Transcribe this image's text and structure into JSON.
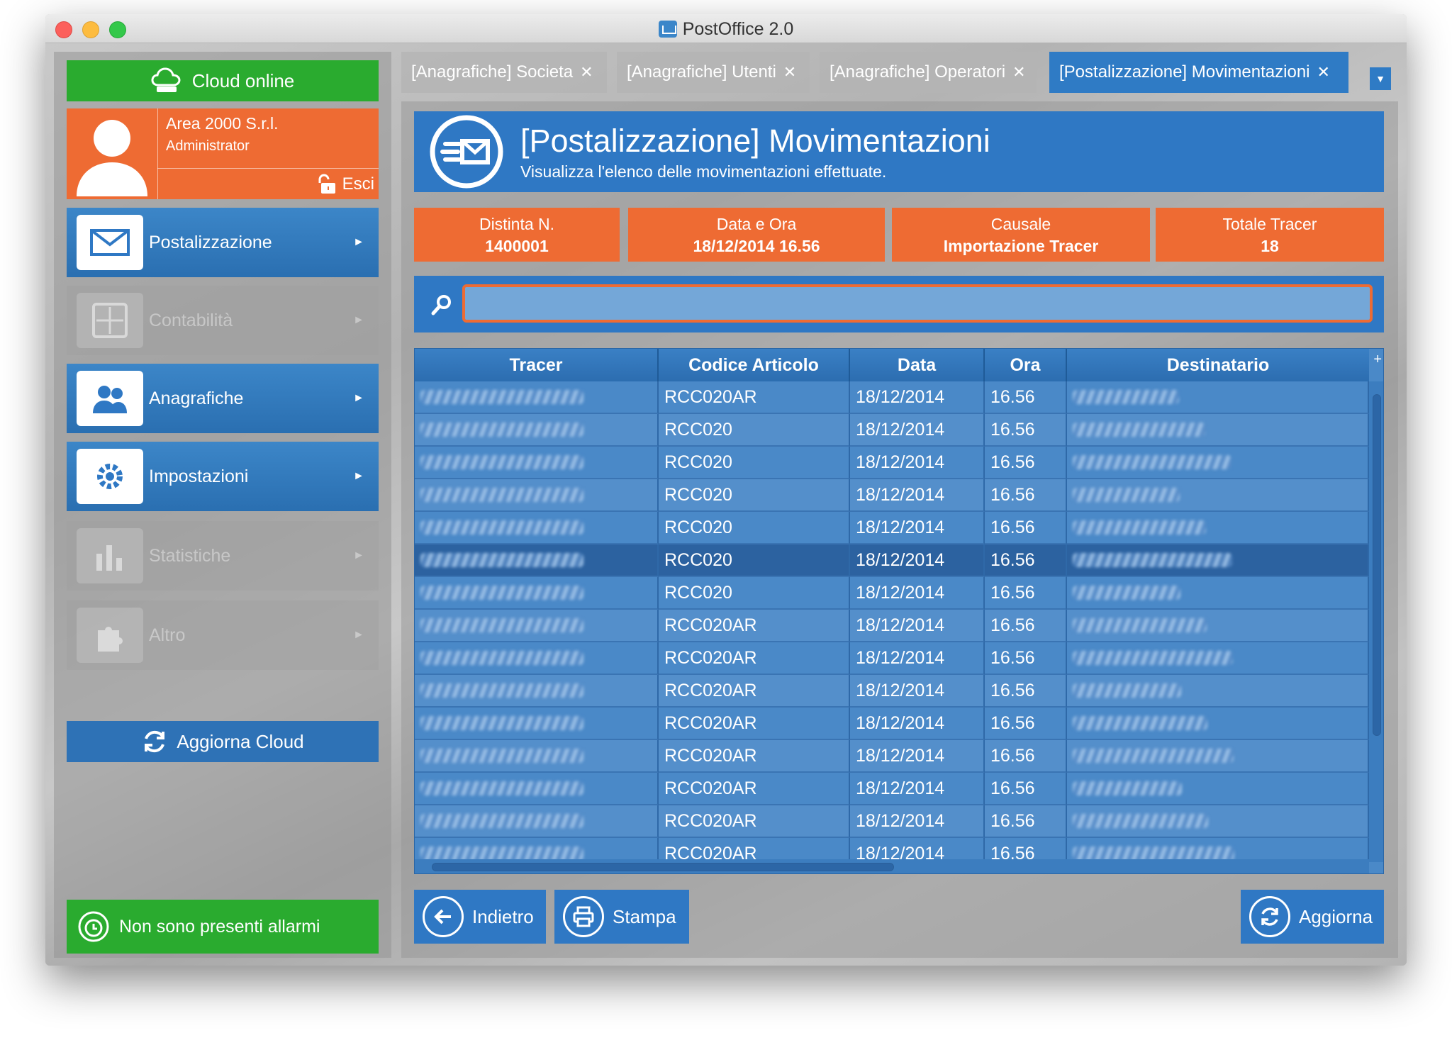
{
  "window": {
    "title": "PostOffice 2.0"
  },
  "sidebar": {
    "cloud_status": "Cloud online",
    "user": {
      "company": "Area 2000 S.r.l.",
      "role": "Administrator",
      "logout": "Esci"
    },
    "items": [
      {
        "label": "Postalizzazione",
        "enabled": true
      },
      {
        "label": "Contabilità",
        "enabled": false
      },
      {
        "label": "Anagrafiche",
        "enabled": true
      },
      {
        "label": "Impostazioni",
        "enabled": true
      },
      {
        "label": "Statistiche",
        "enabled": false
      },
      {
        "label": "Altro",
        "enabled": false
      }
    ],
    "refresh_cloud": "Aggiorna Cloud",
    "alarm_status": "Non sono presenti allarmi"
  },
  "tabs": [
    {
      "label": "[Anagrafiche] Societa",
      "active": false
    },
    {
      "label": "[Anagrafiche] Utenti",
      "active": false
    },
    {
      "label": "[Anagrafiche] Operatori",
      "active": false
    },
    {
      "label": "[Postalizzazione] Movimentazioni",
      "active": true
    }
  ],
  "header": {
    "title": "[Postalizzazione] Movimentazioni",
    "subtitle": "Visualizza l'elenco delle movimentazioni effettuate."
  },
  "info": [
    {
      "label": "Distinta N.",
      "value": "1400001"
    },
    {
      "label": "Data e Ora",
      "value": "18/12/2014 16.56"
    },
    {
      "label": "Causale",
      "value": "Importazione Tracer"
    },
    {
      "label": "Totale Tracer",
      "value": "18"
    }
  ],
  "search": {
    "value": ""
  },
  "table": {
    "columns": [
      "Tracer",
      "Codice Articolo",
      "Data",
      "Ora",
      "Destinatario"
    ],
    "rows": [
      {
        "codice": "RCC020AR",
        "data": "18/12/2014",
        "ora": "16.56"
      },
      {
        "codice": "RCC020",
        "data": "18/12/2014",
        "ora": "16.56"
      },
      {
        "codice": "RCC020",
        "data": "18/12/2014",
        "ora": "16.56"
      },
      {
        "codice": "RCC020",
        "data": "18/12/2014",
        "ora": "16.56"
      },
      {
        "codice": "RCC020",
        "data": "18/12/2014",
        "ora": "16.56"
      },
      {
        "codice": "RCC020",
        "data": "18/12/2014",
        "ora": "16.56"
      },
      {
        "codice": "RCC020",
        "data": "18/12/2014",
        "ora": "16.56"
      },
      {
        "codice": "RCC020AR",
        "data": "18/12/2014",
        "ora": "16.56"
      },
      {
        "codice": "RCC020AR",
        "data": "18/12/2014",
        "ora": "16.56"
      },
      {
        "codice": "RCC020AR",
        "data": "18/12/2014",
        "ora": "16.56"
      },
      {
        "codice": "RCC020AR",
        "data": "18/12/2014",
        "ora": "16.56"
      },
      {
        "codice": "RCC020AR",
        "data": "18/12/2014",
        "ora": "16.56"
      },
      {
        "codice": "RCC020AR",
        "data": "18/12/2014",
        "ora": "16.56"
      },
      {
        "codice": "RCC020AR",
        "data": "18/12/2014",
        "ora": "16.56"
      },
      {
        "codice": "RCC020AR",
        "data": "18/12/2014",
        "ora": "16.56"
      }
    ],
    "selected_row": 5
  },
  "buttons": {
    "back": "Indietro",
    "print": "Stampa",
    "refresh": "Aggiorna"
  },
  "colors": {
    "accent_blue": "#2f78c4",
    "accent_orange": "#ee6b33",
    "status_green": "#2aab2f"
  }
}
